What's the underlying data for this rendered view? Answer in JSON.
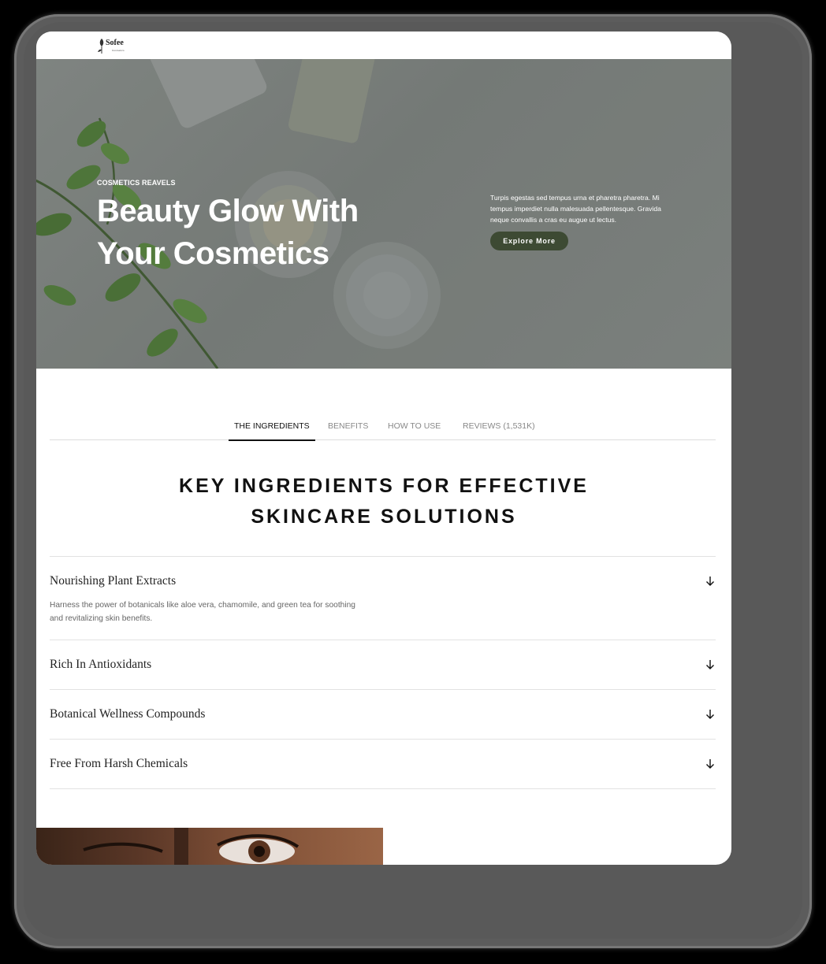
{
  "header": {
    "logo": {
      "name": "Sofee",
      "tagline": "Cosmetics"
    }
  },
  "hero": {
    "eyebrow": "COSMETICS REAVELS",
    "title_line1": "Beauty Glow With",
    "title_line2": "Your Cosmetics",
    "description": "Turpis egestas sed tempus urna et pharetra pharetra. Mi tempus imperdiet nulla malesuada pellentesque. Gravida neque convallis a cras eu augue ut lectus.",
    "button_label": "Explore More"
  },
  "tabs": [
    {
      "label": "THE INGREDIENTS",
      "active": true
    },
    {
      "label": "BENEFITS",
      "active": false
    },
    {
      "label": "HOW TO USE",
      "active": false
    },
    {
      "label": "REVIEWS (1,531K)",
      "active": false
    }
  ],
  "section": {
    "title_line1": "KEY INGREDIENTS FOR EFFECTIVE",
    "title_line2": "SKINCARE SOLUTIONS"
  },
  "accordion": [
    {
      "title": "Nourishing Plant Extracts",
      "expanded": true,
      "body": "Harness the power of botanicals like aloe vera, chamomile, and green tea for soothing and revitalizing skin benefits."
    },
    {
      "title": "Rich In Antioxidants",
      "expanded": false
    },
    {
      "title": "Botanical Wellness Compounds",
      "expanded": false
    },
    {
      "title": "Free From Harsh Chemicals",
      "expanded": false
    }
  ],
  "colors": {
    "accent": "#3d4a33",
    "hero_bg": "#838884",
    "text_dark": "#111111"
  },
  "icons": {
    "accordion": "arrow-down-icon",
    "logo": "leaf-icon"
  }
}
